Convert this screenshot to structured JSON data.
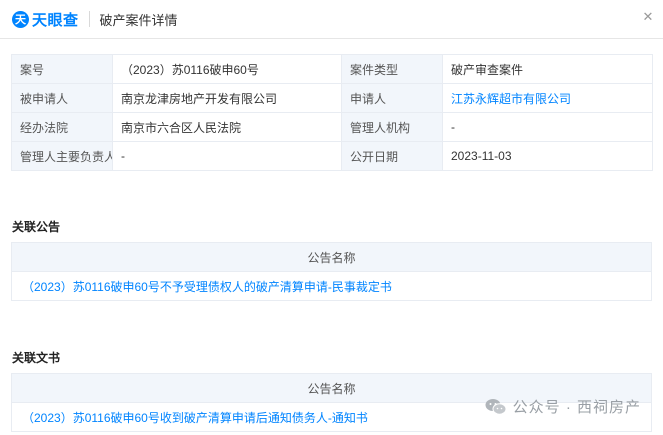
{
  "header": {
    "logo_mark": "天",
    "logo_text": "天眼查",
    "title": "破产案件详情"
  },
  "info": {
    "rows": [
      [
        {
          "label": "案号",
          "value": "（2023）苏0116破申60号"
        },
        {
          "label": "案件类型",
          "value": "破产审查案件"
        }
      ],
      [
        {
          "label": "被申请人",
          "value": "南京龙津房地产开发有限公司"
        },
        {
          "label": "申请人",
          "value": "江苏永辉超市有限公司",
          "link": true
        }
      ],
      [
        {
          "label": "经办法院",
          "value": "南京市六合区人民法院"
        },
        {
          "label": "管理人机构",
          "value": "-"
        }
      ],
      [
        {
          "label": "管理人主要负责人",
          "value": "-"
        },
        {
          "label": "公开日期",
          "value": "2023-11-03"
        }
      ]
    ]
  },
  "announcements": {
    "title": "关联公告",
    "column": "公告名称",
    "items": [
      "（2023）苏0116破申60号不予受理债权人的破产清算申请-民事裁定书"
    ]
  },
  "documents": {
    "title": "关联文书",
    "column": "公告名称",
    "items": [
      "（2023）苏0116破申60号收到破产清算申请后通知债务人-通知书"
    ]
  },
  "watermark": {
    "text": "公众号 · 西祠房产",
    "icon": "wechat-icon"
  },
  "colors": {
    "brand": "#0084ff",
    "label_bg": "#f2f6fb",
    "border": "#e8ecf2"
  }
}
